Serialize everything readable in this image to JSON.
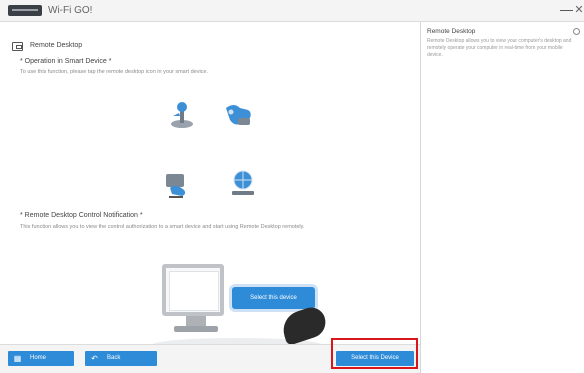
{
  "window": {
    "title": "Wi-Fi GO!",
    "minimize_glyph": "—",
    "close_glyph": "✕"
  },
  "main": {
    "section_title": "Remote Desktop",
    "operation": {
      "heading": "* Operation in Smart Device *",
      "text": "To use this function, please tap the remote desktop icon in your smart device."
    },
    "notification": {
      "heading": "* Remote Desktop Control Notification *",
      "text": "This function allows you to view the control authorization to a smart device and start using Remote Desktop remotely."
    },
    "illustration": {
      "bubble_label": "Select this device"
    }
  },
  "footer": {
    "home_label": "Home",
    "back_label": "Back",
    "select_label": "Select this Device"
  },
  "side_panel": {
    "title": "Remote Desktop",
    "text": "Remote Desktop allows you to view your computer's desktop and remotely operate your computer in real-time from your mobile device."
  },
  "colors": {
    "accent": "#2e8bd8",
    "highlight": "#d9161c",
    "panel_border": "#d6d6d6"
  },
  "icons": [
    "remote-desktop-icon",
    "joystick-icon",
    "controller-icon",
    "pc-controller-icon",
    "globe-icon",
    "home-icon",
    "back-icon",
    "info-icon"
  ]
}
